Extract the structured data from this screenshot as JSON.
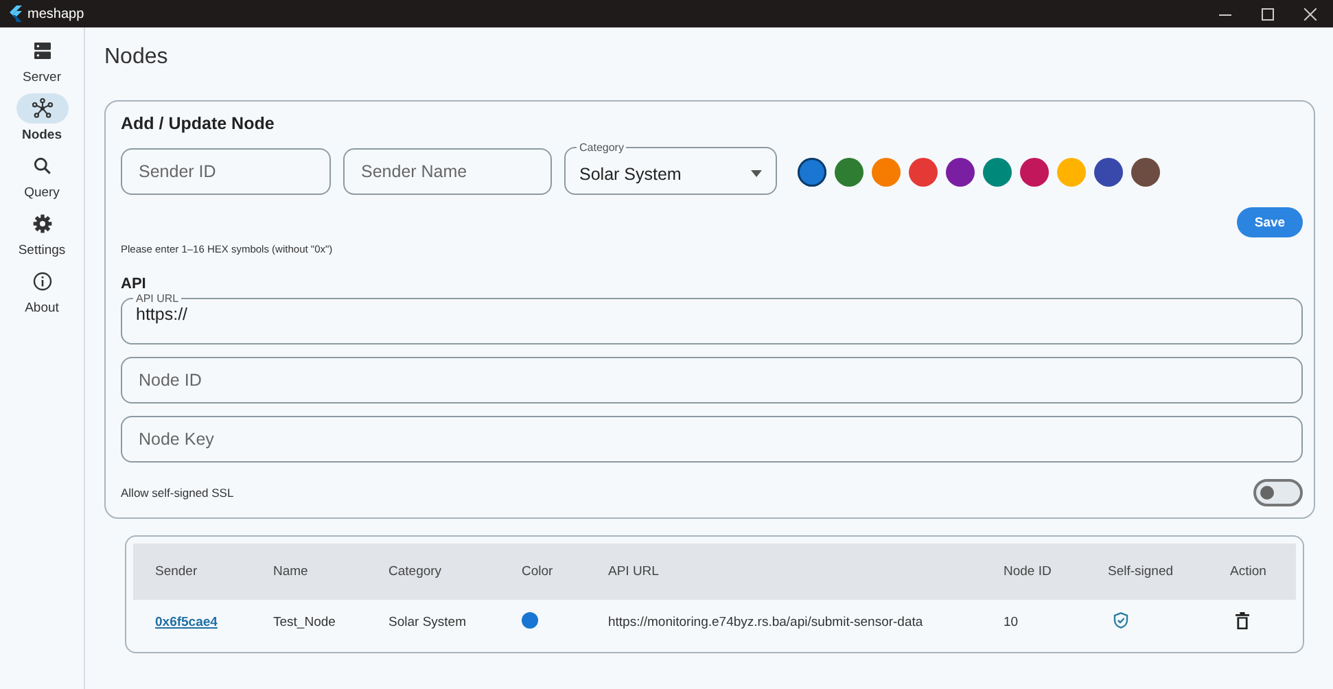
{
  "window": {
    "title": "meshapp"
  },
  "sidebar": {
    "items": [
      {
        "label": "Server",
        "kind": "server",
        "selected": false
      },
      {
        "label": "Nodes",
        "kind": "nodes",
        "selected": true
      },
      {
        "label": "Query",
        "kind": "search",
        "selected": false
      },
      {
        "label": "Settings",
        "kind": "settings",
        "selected": false
      },
      {
        "label": "About",
        "kind": "info",
        "selected": false
      }
    ]
  },
  "page": {
    "title": "Nodes"
  },
  "form": {
    "title": "Add / Update Node",
    "sender_id": {
      "placeholder": "Sender ID"
    },
    "sender_name": {
      "placeholder": "Sender Name"
    },
    "category": {
      "label": "Category",
      "value": "Solar System"
    },
    "colors": [
      {
        "color": "#1976d2",
        "selected": true
      },
      {
        "color": "#2e7d32",
        "selected": false
      },
      {
        "color": "#f57c00",
        "selected": false
      },
      {
        "color": "#e53935",
        "selected": false
      },
      {
        "color": "#7b1fa2",
        "selected": false
      },
      {
        "color": "#00897b",
        "selected": false
      },
      {
        "color": "#c2185b",
        "selected": false
      },
      {
        "color": "#ffb300",
        "selected": false
      },
      {
        "color": "#3949ab",
        "selected": false
      },
      {
        "color": "#6d4c41",
        "selected": false
      }
    ],
    "save_button": "Save",
    "hint": "Please enter 1–16 HEX symbols (without \"0x\")",
    "api_heading": "API",
    "api_url": {
      "label": "API URL",
      "value": "https://"
    },
    "node_id": {
      "placeholder": "Node ID"
    },
    "node_key": {
      "placeholder": "Node Key"
    },
    "self_signed": {
      "label": "Allow self-signed SSL",
      "on": false
    }
  },
  "table": {
    "columns": [
      "Sender",
      "Name",
      "Category",
      "Color",
      "API URL",
      "Node ID",
      "Self-signed",
      "Action"
    ],
    "rows": [
      {
        "sender": "0x6f5cae4",
        "name": "Test_Node",
        "category": "Solar System",
        "color": "#1976d2",
        "api_url": "https://monitoring.e74byz.rs.ba/api/submit-sensor-data",
        "node_id": "10",
        "self_signed": true
      }
    ]
  }
}
